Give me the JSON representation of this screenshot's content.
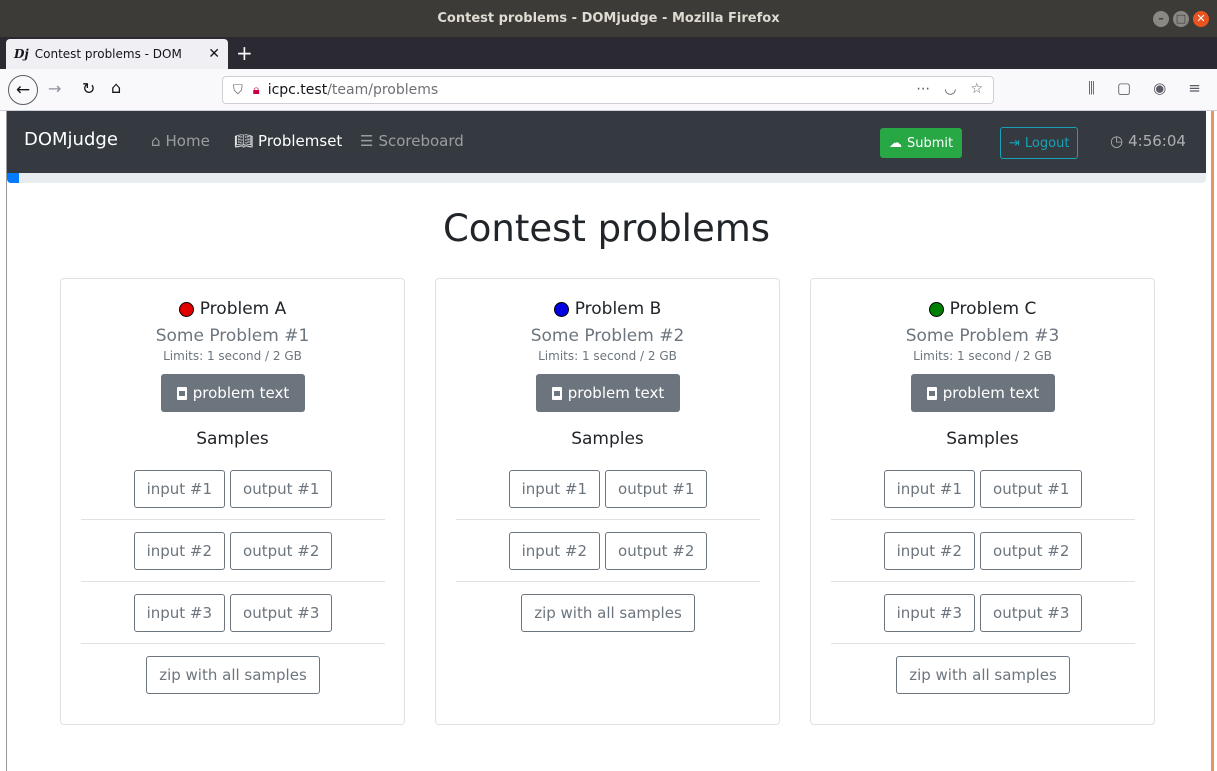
{
  "window": {
    "title": "Contest problems - DOMjudge - Mozilla Firefox",
    "tab_favicon": "Dj",
    "tab_title": "Contest problems - DOM",
    "url_host": "icpc.test",
    "url_path": "/team/problems",
    "minimize_glyph": "–",
    "maximize_glyph": "□",
    "close_glyph": "✕"
  },
  "app": {
    "brand": "DOMjudge",
    "nav": {
      "home": "Home",
      "problemset": "Problemset",
      "scoreboard": "Scoreboard"
    },
    "submit_label": "Submit",
    "logout_label": "Logout",
    "clock": "4:56:04",
    "contest_progress": 0.01
  },
  "page": {
    "title": "Contest problems"
  },
  "problems": [
    {
      "label": "Problem A",
      "color": "#e00000",
      "name": "Some Problem #1",
      "limits": "Limits: 1 second / 2 GB",
      "text_button": "problem text",
      "samples_heading": "Samples",
      "samples": [
        {
          "input": "input #1",
          "output": "output #1"
        },
        {
          "input": "input #2",
          "output": "output #2"
        },
        {
          "input": "input #3",
          "output": "output #3"
        }
      ],
      "zip_label": "zip with all samples"
    },
    {
      "label": "Problem B",
      "color": "#0000e0",
      "name": "Some Problem #2",
      "limits": "Limits: 1 second / 2 GB",
      "text_button": "problem text",
      "samples_heading": "Samples",
      "samples": [
        {
          "input": "input #1",
          "output": "output #1"
        },
        {
          "input": "input #2",
          "output": "output #2"
        }
      ],
      "zip_label": "zip with all samples"
    },
    {
      "label": "Problem C",
      "color": "#008000",
      "name": "Some Problem #3",
      "limits": "Limits: 1 second / 2 GB",
      "text_button": "problem text",
      "samples_heading": "Samples",
      "samples": [
        {
          "input": "input #1",
          "output": "output #1"
        },
        {
          "input": "input #2",
          "output": "output #2"
        },
        {
          "input": "input #3",
          "output": "output #3"
        }
      ],
      "zip_label": "zip with all samples"
    }
  ]
}
